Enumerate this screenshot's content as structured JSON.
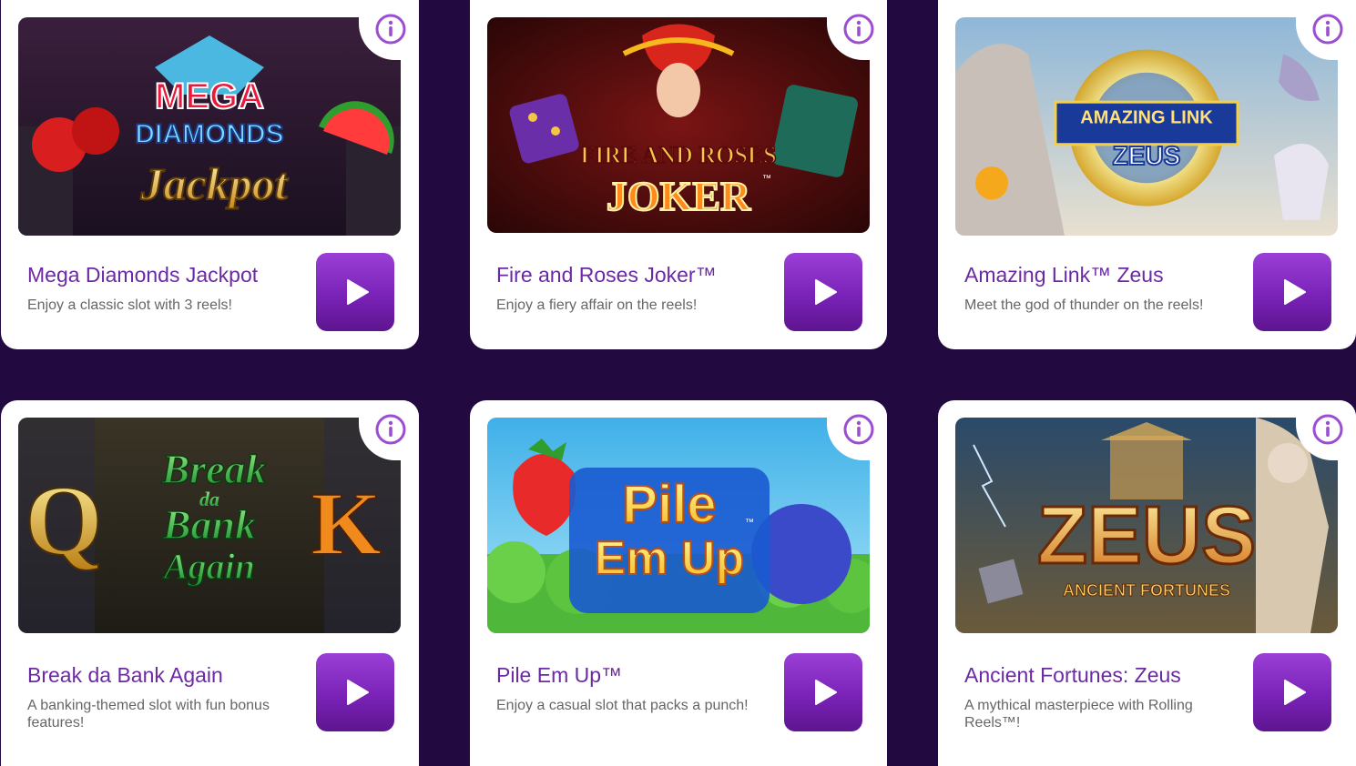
{
  "games": [
    {
      "title": "Mega Diamonds Jackpot",
      "description": "Enjoy a classic slot with 3 reels!",
      "art_text": [
        "MEGA",
        "DIAMONDS",
        "Jackpot"
      ]
    },
    {
      "title": "Fire and Roses Joker™",
      "description": "Enjoy a fiery affair on the reels!",
      "art_text": [
        "FIRE AND ROSES",
        "JOKER",
        "™"
      ]
    },
    {
      "title": "Amazing Link™ Zeus",
      "description": "Meet the god of thunder on the reels!",
      "art_text": [
        "AMAZING LINK",
        "ZEUS"
      ]
    },
    {
      "title": "Break da Bank Again",
      "description": "A banking-themed slot with fun bonus features!",
      "art_text": [
        "Break",
        "da",
        "Bank",
        "Again",
        "Q",
        "K"
      ]
    },
    {
      "title": "Pile Em Up™",
      "description": "Enjoy a casual slot that packs a punch!",
      "art_text": [
        "Pile",
        "Em Up",
        "™"
      ]
    },
    {
      "title": "Ancient Fortunes: Zeus",
      "description": "A mythical masterpiece with Rolling Reels™!",
      "art_text": [
        "ZEUS",
        "ANCIENT FORTUNES"
      ]
    }
  ],
  "icons": {
    "info": "info-circle-icon",
    "play": "play-triangle-icon"
  },
  "colors": {
    "background": "#22093f",
    "card": "#ffffff",
    "title": "#6b2aa3",
    "description": "#666666",
    "play_button_top": "#9a3fd6",
    "play_button_bottom": "#5e158f",
    "info_icon": "#9b4fd0"
  }
}
